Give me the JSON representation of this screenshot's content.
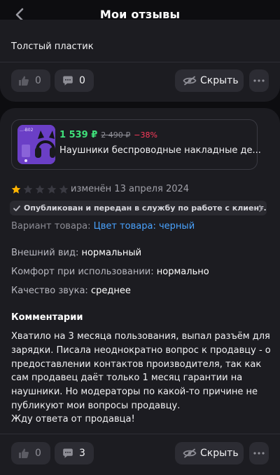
{
  "header": {
    "title": "Мои отзывы",
    "back_icon": "chevron-left-icon"
  },
  "review1": {
    "text": "Толстый пластик",
    "likes": "0",
    "comments": "0",
    "hide_label": "Скрыть"
  },
  "review2": {
    "product": {
      "price": "1 539 ₽",
      "old_price": "2 490 ₽",
      "discount": "−38%",
      "name": "Наушники беспроводные накладные де...",
      "thumb_label": "...-B02"
    },
    "rating": 1,
    "rating_max": 5,
    "edited": "изменён 13 апреля 2024",
    "status": "Опубликован и передан в службу по работе с клиент...",
    "variant_label": "Вариант товара:",
    "variant_value": "Цвет товара: черный",
    "attributes": [
      {
        "label": "Внешний вид:",
        "value": "нормальный"
      },
      {
        "label": "Комфорт при использовании:",
        "value": "нормально"
      },
      {
        "label": "Качество звука:",
        "value": "среднее"
      }
    ],
    "comments_title": "Комментарии",
    "comment_lines": [
      "Хватило на 3 месяца пользования, выпал разъём для",
      "зарядки. Писала неоднократно вопрос к продавцу - о",
      "предоставлении контактов производителя, так как",
      "сам  продавец даёт только 1 месяц гарантии на",
      "наушники. Но модераторы по какой-то причине не",
      "публикуют мои вопросы продавцу.",
      "Жду ответа от продавца!"
    ],
    "likes": "0",
    "comments": "3",
    "hide_label": "Скрыть"
  },
  "colors": {
    "background": "#0d0d10",
    "card": "#1c1c21",
    "pill": "#2c2c33",
    "price": "#3fe07a",
    "discount": "#ff3b5c",
    "link": "#4aa3ff",
    "star": "#ffb400"
  }
}
